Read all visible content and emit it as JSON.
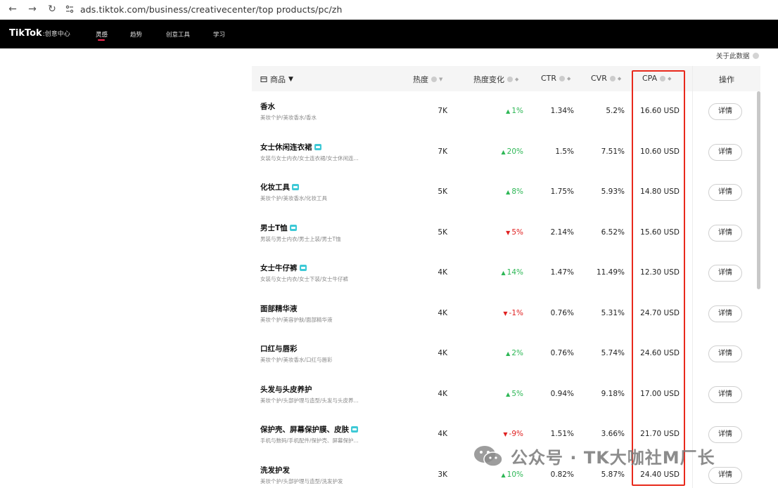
{
  "browser": {
    "url": "ads.tiktok.com/business/creativecenter/top products/pc/zh"
  },
  "topnav": {
    "logo": "TikTok",
    "logo_sub": ":创意中心",
    "items": [
      "灵感",
      "趋势",
      "创意工具",
      "学习"
    ],
    "active_index": 0
  },
  "about_link": "关于此数据",
  "table": {
    "headers": {
      "product": "商品",
      "heat": "热度",
      "heat_change": "热度变化",
      "ctr": "CTR",
      "cvr": "CVR",
      "cpa": "CPA",
      "action": "操作"
    },
    "detail_label": "详情",
    "rows": [
      {
        "name": "香水",
        "tag": false,
        "category": "美妆个护/美妆香水/香水",
        "heat": "7K",
        "change": "1%",
        "direction": "up",
        "ctr": "1.34%",
        "cvr": "5.2%",
        "cpa": "16.60 USD"
      },
      {
        "name": "女士休闲连衣裙",
        "tag": true,
        "category": "女装与女士内衣/女士连衣裙/女士休闲连...",
        "heat": "7K",
        "change": "20%",
        "direction": "up",
        "ctr": "1.5%",
        "cvr": "7.51%",
        "cpa": "10.60 USD"
      },
      {
        "name": "化妆工具",
        "tag": true,
        "category": "美妆个护/美妆香水/化妆工具",
        "heat": "5K",
        "change": "8%",
        "direction": "up",
        "ctr": "1.75%",
        "cvr": "5.93%",
        "cpa": "14.80 USD"
      },
      {
        "name": "男士T恤",
        "tag": true,
        "category": "男装与男士内衣/男士上装/男士T恤",
        "heat": "5K",
        "change": "5%",
        "direction": "down",
        "ctr": "2.14%",
        "cvr": "6.52%",
        "cpa": "15.60 USD"
      },
      {
        "name": "女士牛仔裤",
        "tag": true,
        "category": "女装与女士内衣/女士下装/女士牛仔裤",
        "heat": "4K",
        "change": "14%",
        "direction": "up",
        "ctr": "1.47%",
        "cvr": "11.49%",
        "cpa": "12.30 USD"
      },
      {
        "name": "面部精华液",
        "tag": false,
        "category": "美妆个护/美容护肤/面部精华液",
        "heat": "4K",
        "change": "-1%",
        "direction": "down",
        "ctr": "0.76%",
        "cvr": "5.31%",
        "cpa": "24.70 USD"
      },
      {
        "name": "口红与唇彩",
        "tag": false,
        "category": "美妆个护/美妆香水/口红与唇彩",
        "heat": "4K",
        "change": "2%",
        "direction": "up",
        "ctr": "0.76%",
        "cvr": "5.74%",
        "cpa": "24.60 USD"
      },
      {
        "name": "头发与头皮养护",
        "tag": false,
        "category": "美妆个护/头部护理与造型/头发与头皮养...",
        "heat": "4K",
        "change": "5%",
        "direction": "up",
        "ctr": "0.94%",
        "cvr": "9.18%",
        "cpa": "17.00 USD"
      },
      {
        "name": "保护壳、屏幕保护膜、皮肤",
        "tag": true,
        "category": "手机与数码/手机配件/保护壳、屏幕保护...",
        "heat": "4K",
        "change": "-9%",
        "direction": "down",
        "ctr": "1.51%",
        "cvr": "3.66%",
        "cpa": "21.70 USD"
      },
      {
        "name": "洗发护发",
        "tag": false,
        "category": "美妆个护/头部护理与造型/洗发护发",
        "heat": "3K",
        "change": "10%",
        "direction": "up",
        "ctr": "0.82%",
        "cvr": "5.87%",
        "cpa": "24.40 USD"
      }
    ]
  },
  "watermark": "公众号 · TK大咖社M厂长"
}
